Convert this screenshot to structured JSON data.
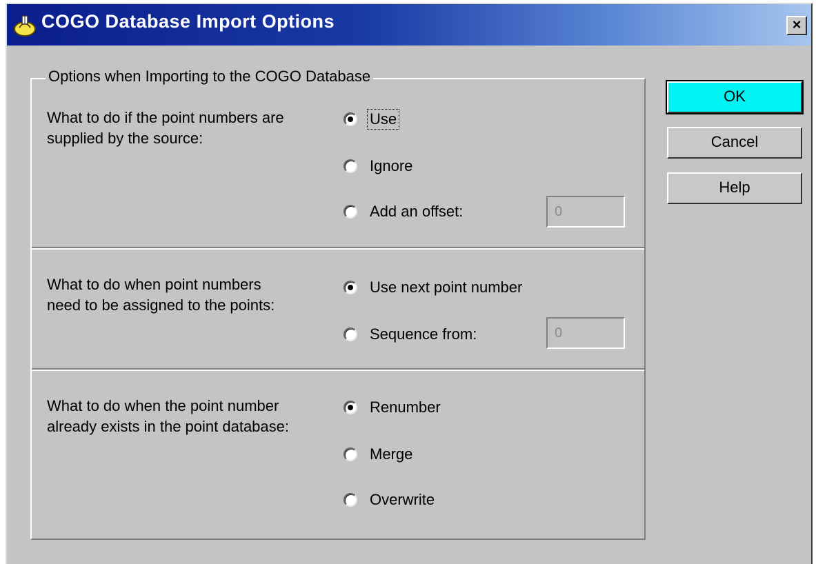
{
  "window": {
    "title": "COGO Database Import Options",
    "close_label": "×"
  },
  "group": {
    "title": "Options when Importing to the COGO Database",
    "sections": [
      {
        "question_line1": "What to do if the point numbers are",
        "question_line2": "supplied by the source:",
        "options": [
          {
            "label": "Use",
            "checked": true
          },
          {
            "label": "Ignore",
            "checked": false
          },
          {
            "label": "Add an offset:",
            "checked": false
          }
        ],
        "field_value": "0"
      },
      {
        "question_line1": "What to do when point numbers",
        "question_line2": "need to be assigned to the points:",
        "options": [
          {
            "label": "Use next point number",
            "checked": true
          },
          {
            "label": "Sequence from:",
            "checked": false
          }
        ],
        "field_value": "0"
      },
      {
        "question_line1": "What to do when the point number",
        "question_line2": "already exists in the point database:",
        "options": [
          {
            "label": "Renumber",
            "checked": true
          },
          {
            "label": "Merge",
            "checked": false
          },
          {
            "label": "Overwrite",
            "checked": false
          }
        ]
      }
    ]
  },
  "buttons": {
    "ok": "OK",
    "cancel": "Cancel",
    "help": "Help"
  },
  "colors": {
    "title_start": "#0a1d8c",
    "title_end": "#a7c6ee",
    "ok_button": "#00f2f2",
    "dialog_bg": "#c4c4c4"
  }
}
